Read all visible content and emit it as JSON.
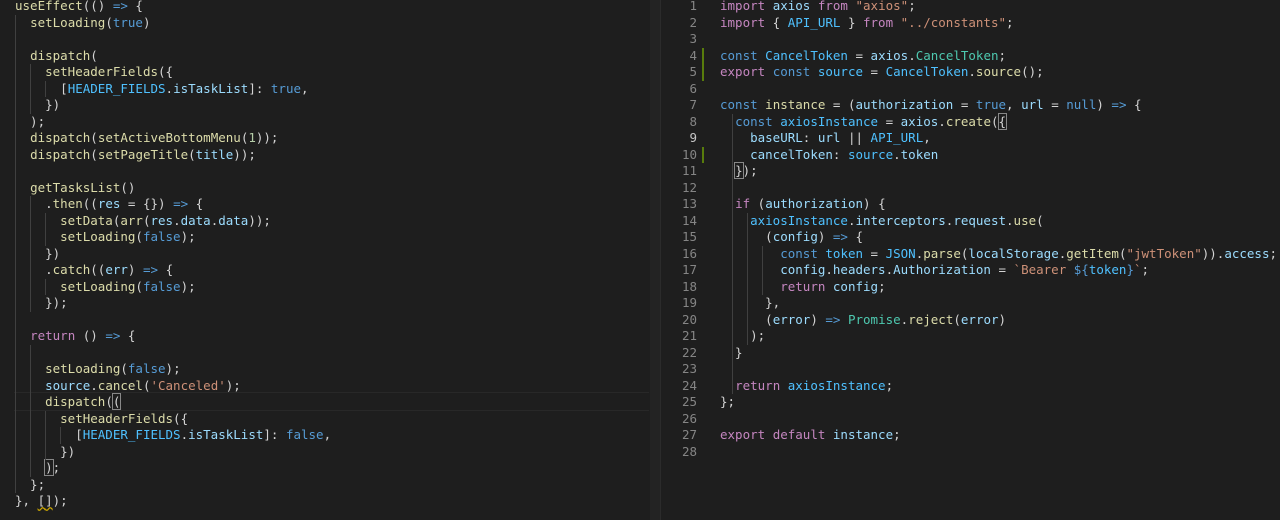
{
  "left_editor": {
    "lines": [
      [
        [
          "useEffect",
          "fn"
        ],
        [
          "(() ",
          ""
        ],
        [
          "=>",
          "kw"
        ],
        [
          " {",
          ""
        ]
      ],
      [
        [
          "  ",
          ""
        ],
        [
          "setLoading",
          "fn"
        ],
        [
          "(",
          ""
        ],
        [
          "true",
          "kw"
        ],
        [
          ")",
          ""
        ]
      ],
      [
        [
          "",
          ""
        ]
      ],
      [
        [
          "  ",
          ""
        ],
        [
          "dispatch",
          "fn"
        ],
        [
          "(",
          ""
        ]
      ],
      [
        [
          "    ",
          ""
        ],
        [
          "setHeaderFields",
          "fn"
        ],
        [
          "({",
          ""
        ]
      ],
      [
        [
          "      [",
          ""
        ],
        [
          "HEADER_FIELDS",
          "cst"
        ],
        [
          ".",
          ""
        ],
        [
          "isTaskList",
          "var"
        ],
        [
          "]: ",
          ""
        ],
        [
          "true",
          "kw"
        ],
        [
          ",",
          ""
        ]
      ],
      [
        [
          "    })",
          ""
        ]
      ],
      [
        [
          "  );",
          ""
        ]
      ],
      [
        [
          "  ",
          ""
        ],
        [
          "dispatch",
          "fn"
        ],
        [
          "(",
          ""
        ],
        [
          "setActiveBottomMenu",
          "fn"
        ],
        [
          "(",
          ""
        ],
        [
          "1",
          "num"
        ],
        [
          "));",
          ""
        ]
      ],
      [
        [
          "  ",
          ""
        ],
        [
          "dispatch",
          "fn"
        ],
        [
          "(",
          ""
        ],
        [
          "setPageTitle",
          "fn"
        ],
        [
          "(",
          ""
        ],
        [
          "title",
          "var"
        ],
        [
          "));",
          ""
        ]
      ],
      [
        [
          "",
          ""
        ]
      ],
      [
        [
          "  ",
          ""
        ],
        [
          "getTasksList",
          "fn"
        ],
        [
          "()",
          ""
        ]
      ],
      [
        [
          "    .",
          ""
        ],
        [
          "then",
          "fn"
        ],
        [
          "((",
          ""
        ],
        [
          "res",
          "var"
        ],
        [
          " = {}) ",
          ""
        ],
        [
          "=>",
          "kw"
        ],
        [
          " {",
          ""
        ]
      ],
      [
        [
          "      ",
          ""
        ],
        [
          "setData",
          "fn"
        ],
        [
          "(",
          ""
        ],
        [
          "arr",
          "fn"
        ],
        [
          "(",
          ""
        ],
        [
          "res",
          "var"
        ],
        [
          ".",
          ""
        ],
        [
          "data",
          "var"
        ],
        [
          ".",
          ""
        ],
        [
          "data",
          "var"
        ],
        [
          "));",
          ""
        ]
      ],
      [
        [
          "      ",
          ""
        ],
        [
          "setLoading",
          "fn"
        ],
        [
          "(",
          ""
        ],
        [
          "false",
          "kw"
        ],
        [
          ");",
          ""
        ]
      ],
      [
        [
          "    })",
          ""
        ]
      ],
      [
        [
          "    .",
          ""
        ],
        [
          "catch",
          "fn"
        ],
        [
          "((",
          ""
        ],
        [
          "err",
          "var"
        ],
        [
          ") ",
          ""
        ],
        [
          "=>",
          "kw"
        ],
        [
          " {",
          ""
        ]
      ],
      [
        [
          "      ",
          ""
        ],
        [
          "setLoading",
          "fn"
        ],
        [
          "(",
          ""
        ],
        [
          "false",
          "kw"
        ],
        [
          ");",
          ""
        ]
      ],
      [
        [
          "    });",
          ""
        ]
      ],
      [
        [
          "",
          ""
        ]
      ],
      [
        [
          "  ",
          ""
        ],
        [
          "return",
          "ctl"
        ],
        [
          " () ",
          ""
        ],
        [
          "=>",
          "kw"
        ],
        [
          " {",
          ""
        ]
      ],
      [
        [
          "",
          ""
        ]
      ],
      [
        [
          "    ",
          ""
        ],
        [
          "setLoading",
          "fn"
        ],
        [
          "(",
          ""
        ],
        [
          "false",
          "kw"
        ],
        [
          ");",
          ""
        ]
      ],
      [
        [
          "    ",
          ""
        ],
        [
          "source",
          "var"
        ],
        [
          ".",
          ""
        ],
        [
          "cancel",
          "fn"
        ],
        [
          "(",
          ""
        ],
        [
          "'Canceled'",
          "str"
        ],
        [
          ");",
          ""
        ]
      ],
      [
        [
          "    ",
          ""
        ],
        [
          "dispatch",
          "fn"
        ],
        [
          "(",
          ""
        ],
        [
          "(",
          "brk"
        ]
      ],
      [
        [
          "      ",
          ""
        ],
        [
          "setHeaderFields",
          "fn"
        ],
        [
          "({",
          ""
        ]
      ],
      [
        [
          "        [",
          ""
        ],
        [
          "HEADER_FIELDS",
          "cst"
        ],
        [
          ".",
          ""
        ],
        [
          "isTaskList",
          "var"
        ],
        [
          "]: ",
          ""
        ],
        [
          "false",
          "kw"
        ],
        [
          ",",
          ""
        ]
      ],
      [
        [
          "      })",
          ""
        ]
      ],
      [
        [
          "    ",
          ""
        ],
        [
          ")",
          "brk"
        ],
        [
          ";",
          ""
        ]
      ],
      [
        [
          "  };",
          ""
        ]
      ],
      [
        [
          "}, ",
          ""
        ],
        [
          "[",
          "sq"
        ],
        [
          "]",
          "sq"
        ],
        [
          ");",
          ""
        ]
      ]
    ]
  },
  "right_editor": {
    "active_line": 9,
    "lines": [
      [
        [
          "import",
          "ctl"
        ],
        [
          " ",
          ""
        ],
        [
          "axios",
          "var"
        ],
        [
          " ",
          ""
        ],
        [
          "from",
          "ctl"
        ],
        [
          " ",
          ""
        ],
        [
          "\"axios\"",
          "str"
        ],
        [
          ";",
          ""
        ]
      ],
      [
        [
          "import",
          "ctl"
        ],
        [
          " { ",
          ""
        ],
        [
          "API_URL",
          "cst"
        ],
        [
          " } ",
          ""
        ],
        [
          "from",
          "ctl"
        ],
        [
          " ",
          ""
        ],
        [
          "\"../constants\"",
          "str"
        ],
        [
          ";",
          ""
        ]
      ],
      [
        [
          "",
          ""
        ]
      ],
      [
        [
          "const",
          "kw"
        ],
        [
          " ",
          ""
        ],
        [
          "CancelToken",
          "cst"
        ],
        [
          " = ",
          ""
        ],
        [
          "axios",
          "var"
        ],
        [
          ".",
          ""
        ],
        [
          "CancelToken",
          "typ"
        ],
        [
          ";",
          ""
        ]
      ],
      [
        [
          "export",
          "ctl"
        ],
        [
          " ",
          ""
        ],
        [
          "const",
          "kw"
        ],
        [
          " ",
          ""
        ],
        [
          "source",
          "cst"
        ],
        [
          " = ",
          ""
        ],
        [
          "CancelToken",
          "cst"
        ],
        [
          ".",
          ""
        ],
        [
          "source",
          "fn"
        ],
        [
          "();",
          ""
        ]
      ],
      [
        [
          "",
          ""
        ]
      ],
      [
        [
          "const",
          "kw"
        ],
        [
          " ",
          ""
        ],
        [
          "instance",
          "fn"
        ],
        [
          " = (",
          ""
        ],
        [
          "authorization",
          "var"
        ],
        [
          " = ",
          ""
        ],
        [
          "true",
          "kw"
        ],
        [
          ", ",
          ""
        ],
        [
          "url",
          "var"
        ],
        [
          " = ",
          ""
        ],
        [
          "null",
          "kw"
        ],
        [
          ") ",
          ""
        ],
        [
          "=>",
          "kw"
        ],
        [
          " {",
          ""
        ]
      ],
      [
        [
          "  ",
          ""
        ],
        [
          "const",
          "kw"
        ],
        [
          " ",
          ""
        ],
        [
          "axiosInstance",
          "cst"
        ],
        [
          " = ",
          ""
        ],
        [
          "axios",
          "var"
        ],
        [
          ".",
          ""
        ],
        [
          "create",
          "fn"
        ],
        [
          "(",
          ""
        ],
        [
          "{",
          "brk"
        ]
      ],
      [
        [
          "    ",
          ""
        ],
        [
          "baseURL",
          "var"
        ],
        [
          ": ",
          ""
        ],
        [
          "url",
          "var"
        ],
        [
          " || ",
          ""
        ],
        [
          "API_URL",
          "cst"
        ],
        [
          ",",
          ""
        ]
      ],
      [
        [
          "    ",
          ""
        ],
        [
          "cancelToken",
          "var"
        ],
        [
          ": ",
          ""
        ],
        [
          "source",
          "cst"
        ],
        [
          ".",
          ""
        ],
        [
          "token",
          "var"
        ]
      ],
      [
        [
          "  ",
          ""
        ],
        [
          "}",
          "brk"
        ],
        [
          ");",
          ""
        ]
      ],
      [
        [
          "",
          ""
        ]
      ],
      [
        [
          "  ",
          ""
        ],
        [
          "if",
          "ctl"
        ],
        [
          " (",
          ""
        ],
        [
          "authorization",
          "var"
        ],
        [
          ") {",
          ""
        ]
      ],
      [
        [
          "    ",
          ""
        ],
        [
          "axiosInstance",
          "cst"
        ],
        [
          ".",
          ""
        ],
        [
          "interceptors",
          "var"
        ],
        [
          ".",
          ""
        ],
        [
          "request",
          "var"
        ],
        [
          ".",
          ""
        ],
        [
          "use",
          "fn"
        ],
        [
          "(",
          ""
        ]
      ],
      [
        [
          "      (",
          ""
        ],
        [
          "config",
          "var"
        ],
        [
          ") ",
          ""
        ],
        [
          "=>",
          "kw"
        ],
        [
          " {",
          ""
        ]
      ],
      [
        [
          "        ",
          ""
        ],
        [
          "const",
          "kw"
        ],
        [
          " ",
          ""
        ],
        [
          "token",
          "cst"
        ],
        [
          " = ",
          ""
        ],
        [
          "JSON",
          "cst"
        ],
        [
          ".",
          ""
        ],
        [
          "parse",
          "fn"
        ],
        [
          "(",
          ""
        ],
        [
          "localStorage",
          "var"
        ],
        [
          ".",
          ""
        ],
        [
          "getItem",
          "fn"
        ],
        [
          "(",
          ""
        ],
        [
          "\"jwtToken\"",
          "str"
        ],
        [
          ")).",
          ""
        ],
        [
          "access",
          "var"
        ],
        [
          ";",
          ""
        ]
      ],
      [
        [
          "        ",
          ""
        ],
        [
          "config",
          "var"
        ],
        [
          ".",
          ""
        ],
        [
          "headers",
          "var"
        ],
        [
          ".",
          ""
        ],
        [
          "Authorization",
          "var"
        ],
        [
          " = ",
          ""
        ],
        [
          "`Bearer ",
          "str"
        ],
        [
          "${",
          "kw"
        ],
        [
          "token",
          "cst"
        ],
        [
          "}",
          "kw"
        ],
        [
          "`",
          "str"
        ],
        [
          ";",
          ""
        ]
      ],
      [
        [
          "        ",
          ""
        ],
        [
          "return",
          "ctl"
        ],
        [
          " ",
          ""
        ],
        [
          "config",
          "var"
        ],
        [
          ";",
          ""
        ]
      ],
      [
        [
          "      },",
          ""
        ]
      ],
      [
        [
          "      (",
          ""
        ],
        [
          "error",
          "var"
        ],
        [
          ") ",
          ""
        ],
        [
          "=>",
          "kw"
        ],
        [
          " ",
          ""
        ],
        [
          "Promise",
          "typ"
        ],
        [
          ".",
          ""
        ],
        [
          "reject",
          "fn"
        ],
        [
          "(",
          ""
        ],
        [
          "error",
          "var"
        ],
        [
          ")",
          ""
        ]
      ],
      [
        [
          "    );",
          ""
        ]
      ],
      [
        [
          "  }",
          ""
        ]
      ],
      [
        [
          "",
          ""
        ]
      ],
      [
        [
          "  ",
          ""
        ],
        [
          "return",
          "ctl"
        ],
        [
          " ",
          ""
        ],
        [
          "axiosInstance",
          "cst"
        ],
        [
          ";",
          ""
        ]
      ],
      [
        [
          "};",
          ""
        ]
      ],
      [
        [
          "",
          ""
        ]
      ],
      [
        [
          "export",
          "ctl"
        ],
        [
          " ",
          ""
        ],
        [
          "default",
          "ctl"
        ],
        [
          " ",
          ""
        ],
        [
          "instance",
          "var"
        ],
        [
          ";",
          ""
        ]
      ],
      [
        [
          "",
          ""
        ]
      ]
    ]
  },
  "colors": {
    "background": "#1e1e1e",
    "keyword": "#569cd6",
    "control": "#c586c0",
    "function": "#dcdcaa",
    "variable": "#9cdcfe",
    "constant": "#4fc1ff",
    "string": "#ce9178",
    "type": "#4ec9b0",
    "number": "#b5cea8",
    "git_modified_gutter": "#587c0c"
  }
}
